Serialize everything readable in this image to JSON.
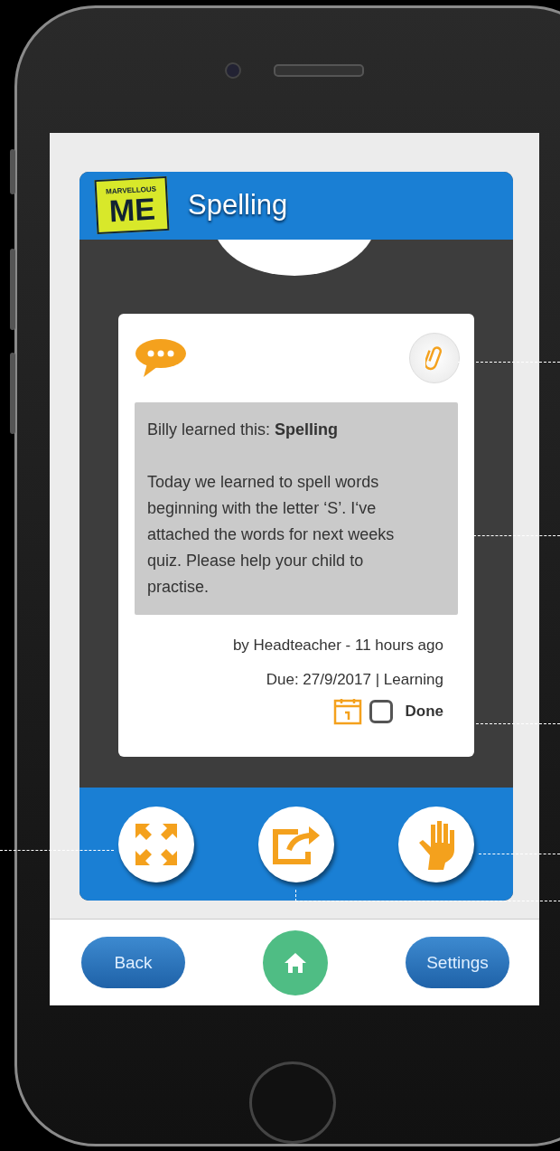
{
  "logo": {
    "top": "MARVELLOUS",
    "main": "ME"
  },
  "header": {
    "title": "Spelling"
  },
  "card": {
    "message": "Billy learned this: **Spelling**",
    "body": "Today we learned to spell words beginning with the letter ‘S’. I‘ve attached the words for next weeks quiz. Please help your child to practise.",
    "byline": "by Headteacher - 11 hours ago",
    "due": "Due: 27/9/2017 | Learning",
    "done": {
      "label": "Done",
      "checked": false
    }
  },
  "actions": [
    {
      "kind": "expand"
    },
    {
      "kind": "share"
    },
    {
      "kind": "hand"
    }
  ],
  "nav": {
    "back": "Back",
    "settings": "Settings"
  }
}
